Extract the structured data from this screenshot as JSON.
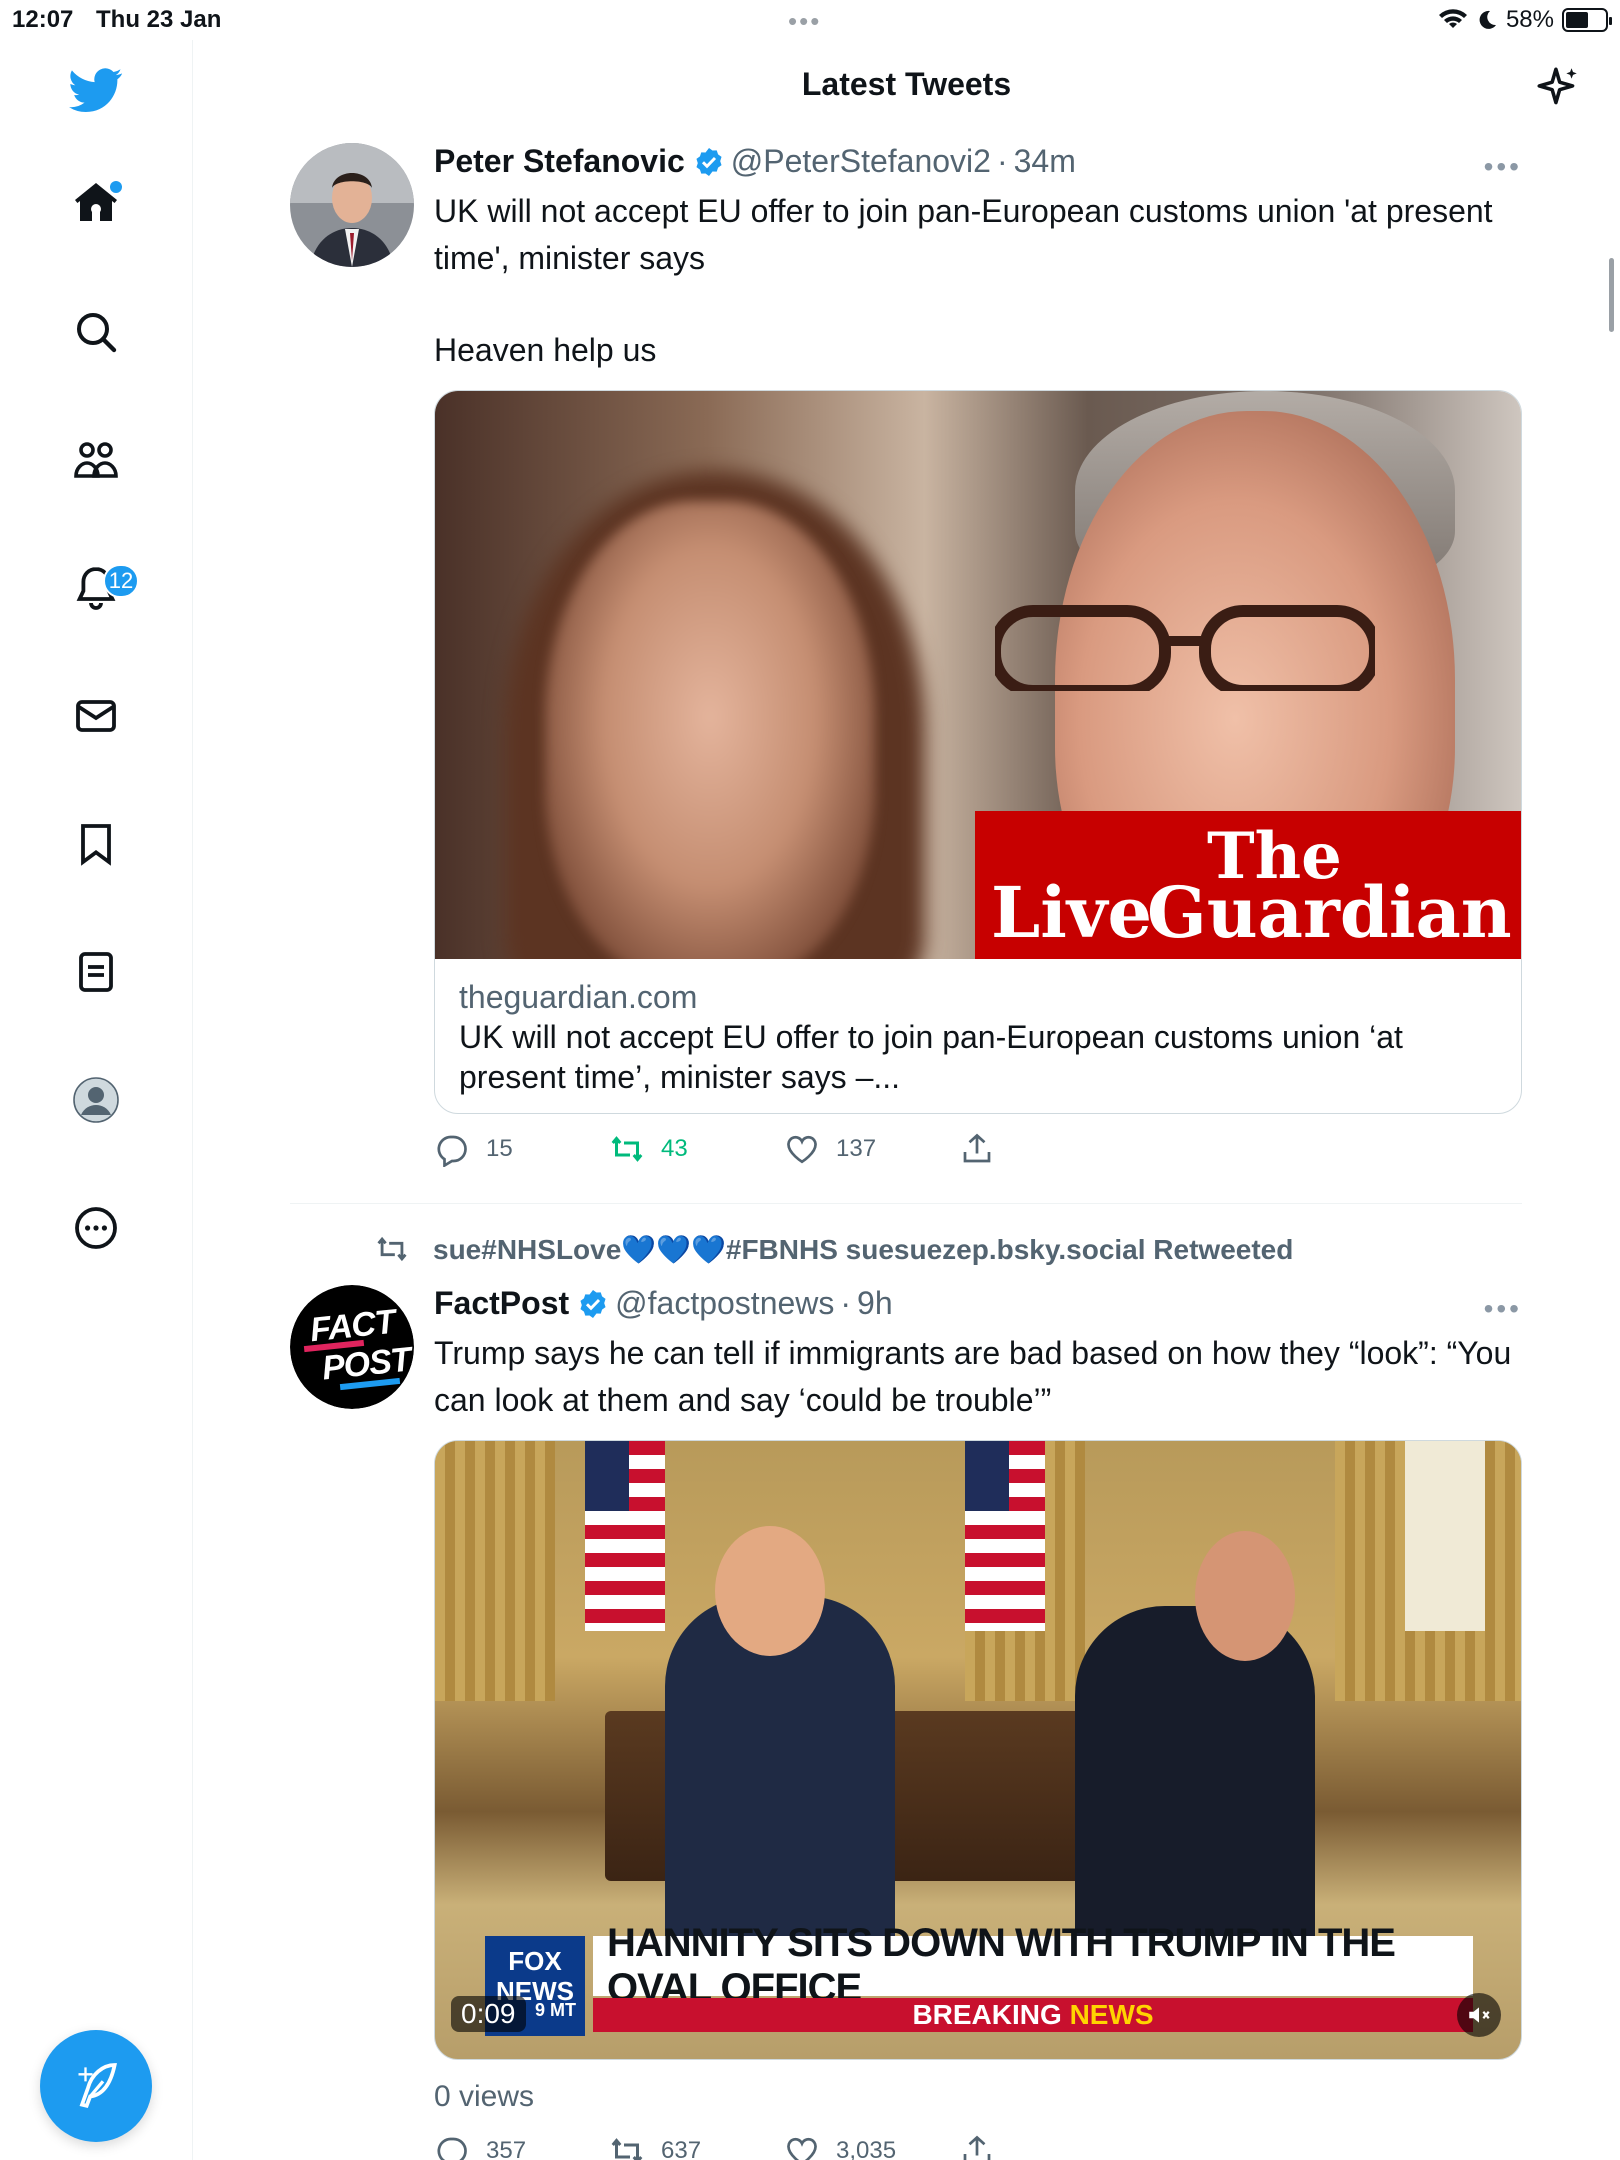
{
  "status_bar": {
    "time": "12:07",
    "date": "Thu 23 Jan",
    "battery": "58%",
    "battery_level": 0.58
  },
  "sidebar": {
    "items": [
      {
        "name": "home",
        "icon": "home-icon"
      },
      {
        "name": "explore",
        "icon": "search-icon"
      },
      {
        "name": "communities",
        "icon": "communities-icon"
      },
      {
        "name": "notifications",
        "icon": "bell-icon",
        "badge": "12"
      },
      {
        "name": "messages",
        "icon": "mail-icon"
      },
      {
        "name": "bookmarks",
        "icon": "bookmark-icon"
      },
      {
        "name": "lists",
        "icon": "lists-icon"
      },
      {
        "name": "profile",
        "icon": "profile-icon"
      },
      {
        "name": "more",
        "icon": "more-icon"
      }
    ],
    "compose_icon": "compose-icon"
  },
  "header": {
    "title": "Latest Tweets",
    "sparkle_icon": "sparkle-icon"
  },
  "tweets": [
    {
      "name": "Peter Stefanovic",
      "handle": "@PeterStefanovi2",
      "sep": "·",
      "time": "34m",
      "text_line1": "UK will not accept EU offer to join pan-European customs union 'at present time', minister says",
      "text_line2": "Heaven help us",
      "card": {
        "logo_the": "The",
        "logo_live": "Live",
        "logo_guardian": "Guardian",
        "domain": "theguardian.com",
        "headline": "UK will not accept EU offer to join pan-European customs union ‘at present time’, minister says –..."
      },
      "actions": {
        "replies": "15",
        "retweets": "43",
        "likes": "137"
      }
    },
    {
      "retweeted_by": "sue#NHSLove💙💙💙#FBNHS suesuezep.bsky.social Retweeted",
      "name": "FactPost",
      "handle": "@factpostnews",
      "sep": "·",
      "time": "9h",
      "text_line1": "Trump says he can tell if immigrants are bad based on how they “look”: “You can look at them and say ‘could be trouble’”",
      "avatar_text_1": "FACT",
      "avatar_text_2": "POST",
      "video": {
        "fox_logo": "FOX NEWS",
        "chyron": "HANNITY SITS DOWN WITH TRUMP IN THE OVAL OFFICE",
        "breaking": "BREAKING",
        "news": "NEWS",
        "time_code": "9 MT",
        "duration": "0:09"
      },
      "views": "0 views",
      "actions": {
        "replies": "357",
        "retweets": "637",
        "likes": "3,035"
      }
    }
  ],
  "colors": {
    "accent": "#1d9bf0",
    "retweet_green": "#00ba7c",
    "guardian_red": "#c70000",
    "secondary_text": "#536471"
  }
}
